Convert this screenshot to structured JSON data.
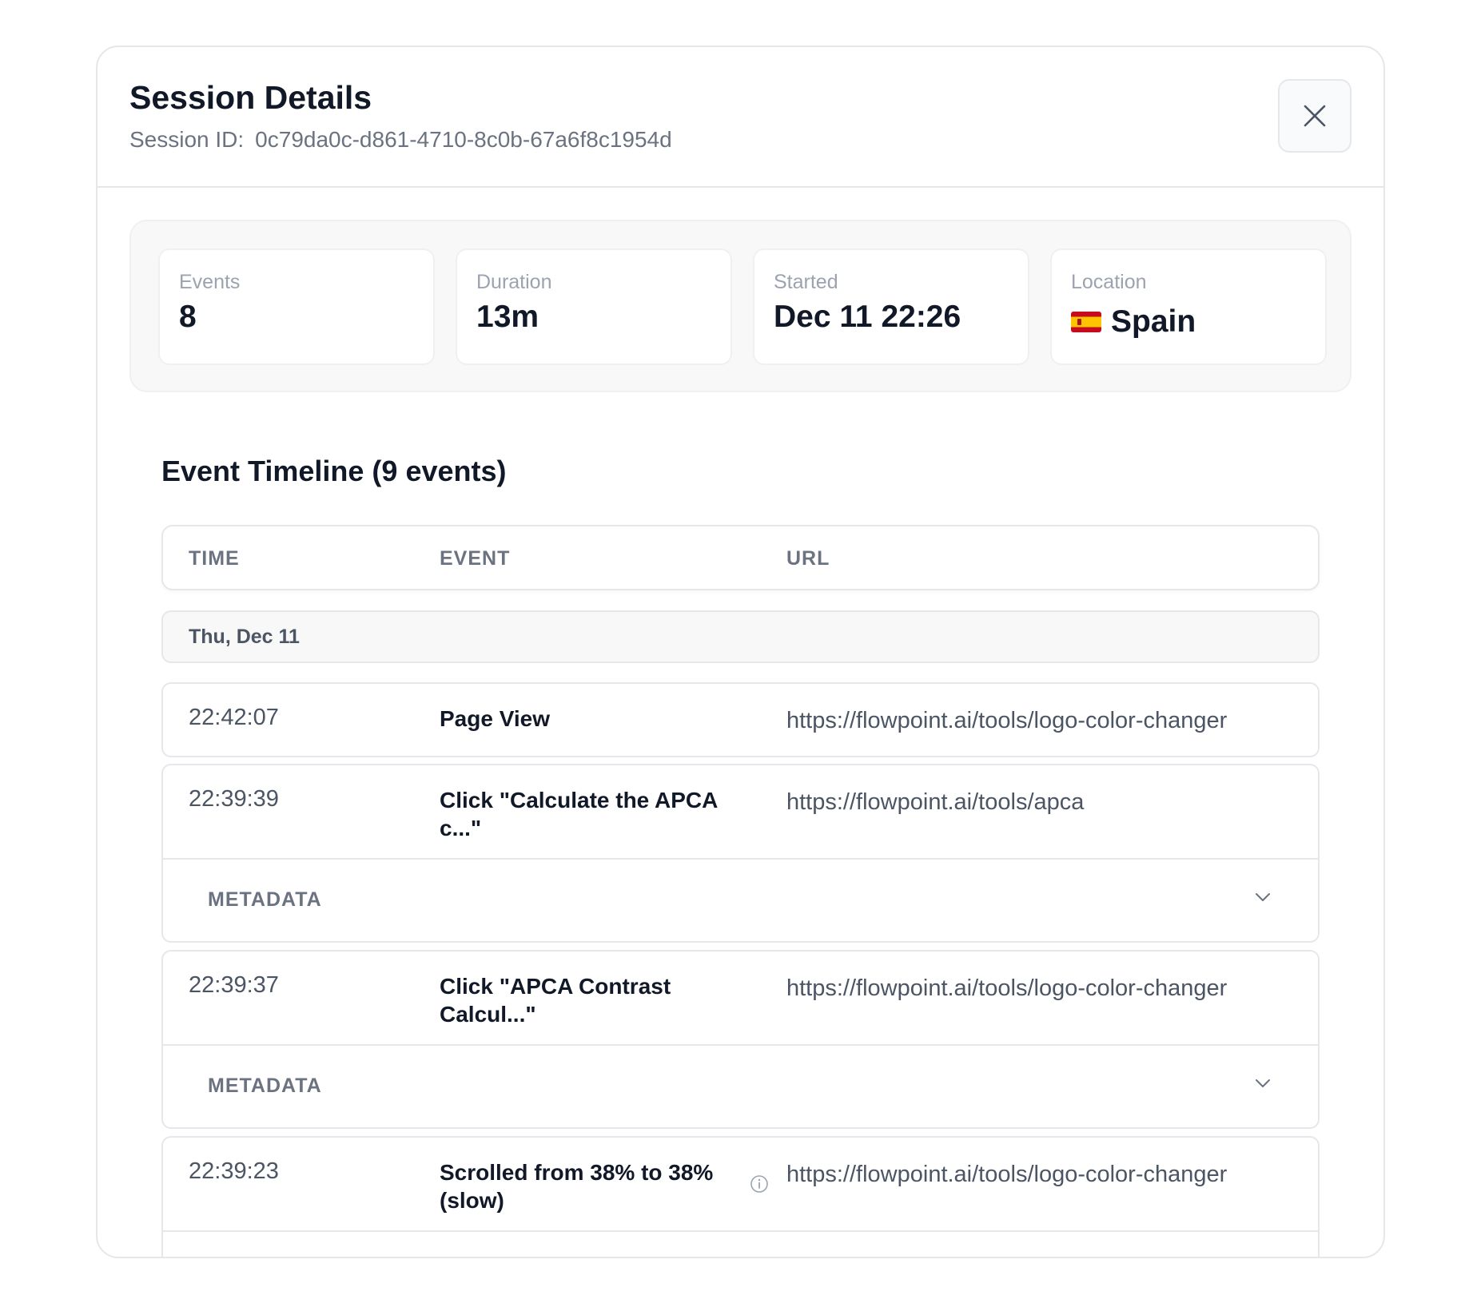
{
  "header": {
    "title": "Session Details",
    "session_id_label": "Session ID:",
    "session_id": "0c79da0c-d861-4710-8c0b-67a6f8c1954d"
  },
  "stats": [
    {
      "label": "Events",
      "value": "8"
    },
    {
      "label": "Duration",
      "value": "13m"
    },
    {
      "label": "Started",
      "value": "Dec 11 22:26"
    },
    {
      "label": "Location",
      "value": "Spain",
      "icon": "spain-flag-icon"
    }
  ],
  "timeline": {
    "title": "Event Timeline (9 events)",
    "columns": [
      "TIME",
      "EVENT",
      "URL"
    ],
    "date_group": "Thu, Dec 11",
    "events": [
      {
        "time": "22:42:07",
        "name": "Page View",
        "url": "https://flowpoint.ai/tools/logo-color-changer"
      },
      {
        "time": "22:39:39",
        "name": "Click \"Calculate the APCA c...\"",
        "url": "https://flowpoint.ai/tools/apca",
        "metadata": "METADATA"
      },
      {
        "time": "22:39:37",
        "name": "Click \"APCA Contrast Calcul...\"",
        "url": "https://flowpoint.ai/tools/logo-color-changer",
        "metadata": "METADATA"
      },
      {
        "time": "22:39:23",
        "name": "Scrolled from 38% to 38% (slow)",
        "url": "https://flowpoint.ai/tools/logo-color-changer"
      }
    ]
  },
  "colors": {
    "border": "#e5e7eb",
    "muted_text": "#6b7280",
    "panel_bg": "#f8f8f9"
  }
}
